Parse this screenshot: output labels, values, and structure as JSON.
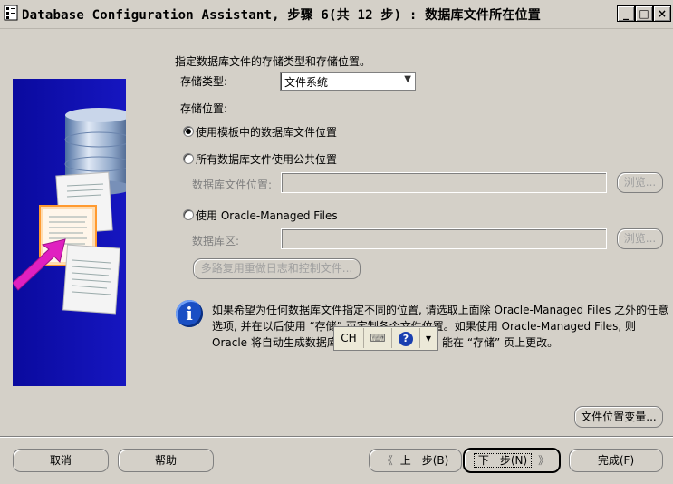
{
  "window": {
    "title": "Database Configuration Assistant, 步骤 6(共 12 步) : 数据库文件所在位置",
    "min_glyph": "_",
    "max_glyph": "□",
    "close_glyph": "×"
  },
  "main": {
    "intro": "指定数据库文件的存储类型和存储位置。",
    "storage_type_label": "存储类型:",
    "storage_type_value": "文件系统",
    "storage_location_label": "存储位置:",
    "radio_template": "使用模板中的数据库文件位置",
    "radio_common": "所有数据库文件使用公共位置",
    "db_file_location_label": "数据库文件位置:",
    "db_file_location_value": "",
    "browse_label": "浏览...",
    "radio_omf": "使用 Oracle-Managed Files",
    "db_area_label": "数据库区:",
    "db_area_value": "",
    "multiplex_button": "多路复用重做日志和控制文件...",
    "info_line1": "如果希望为任何数据库文件指定不同的位置, 请选取上面除 Oracle-Managed Files 之外的任意",
    "info_line2": "选项, 并在以后使用 “存储” 页定制各个文件位置。如果使用 Oracle-Managed Files, 则",
    "info_line3a": "Oracle 将自动生成数据库",
    "info_line3b": "能在 “存储” 页上更改。",
    "file_location_vars_button": "文件位置变量..."
  },
  "ime": {
    "lang": "CH",
    "keyboard_glyph": "⌨",
    "help_glyph": "?",
    "menu_glyph": "▾"
  },
  "footer": {
    "cancel": "取消",
    "help": "帮助",
    "back": "上一步(B)",
    "next": "下一步(N)",
    "finish": "完成(F)",
    "back_arrow": "《",
    "next_arrow": "》"
  }
}
